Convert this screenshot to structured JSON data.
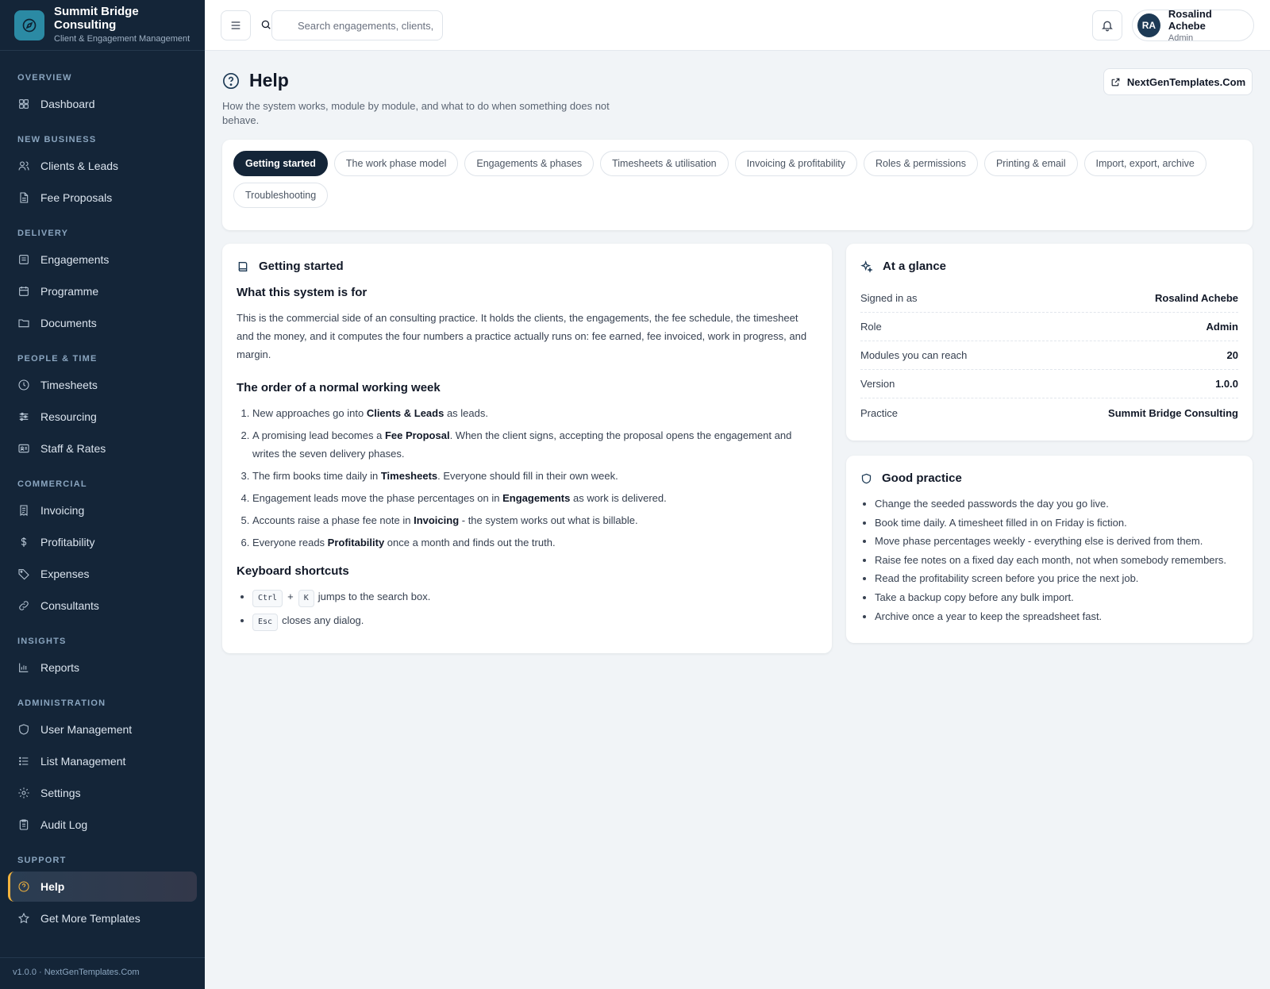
{
  "brand": {
    "name": "Summit Bridge Consulting",
    "subtitle": "Client & Engagement Management"
  },
  "sidebar": {
    "sections": [
      {
        "label": "Overview",
        "items": [
          {
            "label": "Dashboard",
            "icon": "dashboard-icon"
          }
        ]
      },
      {
        "label": "New Business",
        "items": [
          {
            "label": "Clients & Leads",
            "icon": "users-icon"
          },
          {
            "label": "Fee Proposals",
            "icon": "document-icon"
          }
        ]
      },
      {
        "label": "Delivery",
        "items": [
          {
            "label": "Engagements",
            "icon": "briefcase-icon"
          },
          {
            "label": "Programme",
            "icon": "calendar-icon"
          },
          {
            "label": "Documents",
            "icon": "folder-icon"
          }
        ]
      },
      {
        "label": "People & Time",
        "items": [
          {
            "label": "Timesheets",
            "icon": "clock-icon"
          },
          {
            "label": "Resourcing",
            "icon": "sliders-icon"
          },
          {
            "label": "Staff & Rates",
            "icon": "id-card-icon"
          }
        ]
      },
      {
        "label": "Commercial",
        "items": [
          {
            "label": "Invoicing",
            "icon": "receipt-icon"
          },
          {
            "label": "Profitability",
            "icon": "dollar-icon"
          },
          {
            "label": "Expenses",
            "icon": "tag-icon"
          },
          {
            "label": "Consultants",
            "icon": "link-icon"
          }
        ]
      },
      {
        "label": "Insights",
        "items": [
          {
            "label": "Reports",
            "icon": "bar-chart-icon"
          }
        ]
      },
      {
        "label": "Administration",
        "items": [
          {
            "label": "User Management",
            "icon": "shield-icon"
          },
          {
            "label": "List Management",
            "icon": "list-icon"
          },
          {
            "label": "Settings",
            "icon": "gear-icon"
          },
          {
            "label": "Audit Log",
            "icon": "clipboard-icon"
          }
        ]
      },
      {
        "label": "Support",
        "items": [
          {
            "label": "Help",
            "icon": "help-circle-icon",
            "active": true
          },
          {
            "label": "Get More Templates",
            "icon": "star-icon"
          }
        ]
      }
    ],
    "footer": "v1.0.0 · NextGenTemplates.Com"
  },
  "topbar": {
    "search_placeholder": "Search engagements, clients, s",
    "user": {
      "initials": "RA",
      "name": "Rosalind Achebe",
      "role": "Admin"
    }
  },
  "page": {
    "title": "Help",
    "subtitle": "How the system works, module by module, and what to do when something does not behave.",
    "external_link": "NextGenTemplates.Com"
  },
  "tabs": [
    {
      "label": "Getting started",
      "active": true
    },
    {
      "label": "The work phase model"
    },
    {
      "label": "Engagements & phases"
    },
    {
      "label": "Timesheets & utilisation"
    },
    {
      "label": "Invoicing & profitability"
    },
    {
      "label": "Roles & permissions"
    },
    {
      "label": "Printing & email"
    },
    {
      "label": "Import, export, archive"
    },
    {
      "label": "Troubleshooting"
    }
  ],
  "guide": {
    "title": "Getting started",
    "section1_title": "What this system is for",
    "section1_text": "This is the commercial side of an consulting practice. It holds the clients, the engagements, the fee schedule, the timesheet and the money, and it computes the four numbers a practice actually runs on: fee earned, fee invoiced, work in progress, and margin.",
    "section2_title": "The order of a normal working week",
    "steps": [
      {
        "pre": "New approaches go into ",
        "bold": "Clients & Leads",
        "post": " as leads."
      },
      {
        "pre": "A promising lead becomes a ",
        "bold": "Fee Proposal",
        "post": ". When the client signs, accepting the proposal opens the engagement and writes the seven delivery phases."
      },
      {
        "pre": "The firm books time daily in ",
        "bold": "Timesheets",
        "post": ". Everyone should fill in their own week."
      },
      {
        "pre": "Engagement leads move the phase percentages on in ",
        "bold": "Engagements",
        "post": " as work is delivered."
      },
      {
        "pre": "Accounts raise a phase fee note in ",
        "bold": "Invoicing",
        "post": " - the system works out what is billable."
      },
      {
        "pre": "Everyone reads ",
        "bold": "Profitability",
        "post": " once a month and finds out the truth."
      }
    ],
    "section3_title": "Keyboard shortcuts",
    "shortcuts": [
      {
        "keys": [
          "Ctrl",
          "K"
        ],
        "joiner": "+",
        "text": "jumps to the search box."
      },
      {
        "keys": [
          "Esc"
        ],
        "text": "closes any dialog."
      }
    ]
  },
  "glance": {
    "title": "At a glance",
    "rows": [
      {
        "label": "Signed in as",
        "value": "Rosalind Achebe"
      },
      {
        "label": "Role",
        "value": "Admin"
      },
      {
        "label": "Modules you can reach",
        "value": "20"
      },
      {
        "label": "Version",
        "value": "1.0.0"
      },
      {
        "label": "Practice",
        "value": "Summit Bridge Consulting"
      }
    ]
  },
  "practice": {
    "title": "Good practice",
    "items": [
      "Change the seeded passwords the day you go live.",
      "Book time daily. A timesheet filled in on Friday is fiction.",
      "Move phase percentages weekly - everything else is derived from them.",
      "Raise fee notes on a fixed day each month, not when somebody remembers.",
      "Read the profitability screen before you price the next job.",
      "Take a backup copy before any bulk import.",
      "Archive once a year to keep the spreadsheet fast."
    ]
  },
  "colors": {
    "sidebar_bg": "#142538",
    "accent": "#f2b33d",
    "brand_logo": "#2b8aa4",
    "page_bg": "#f1f4f7"
  }
}
